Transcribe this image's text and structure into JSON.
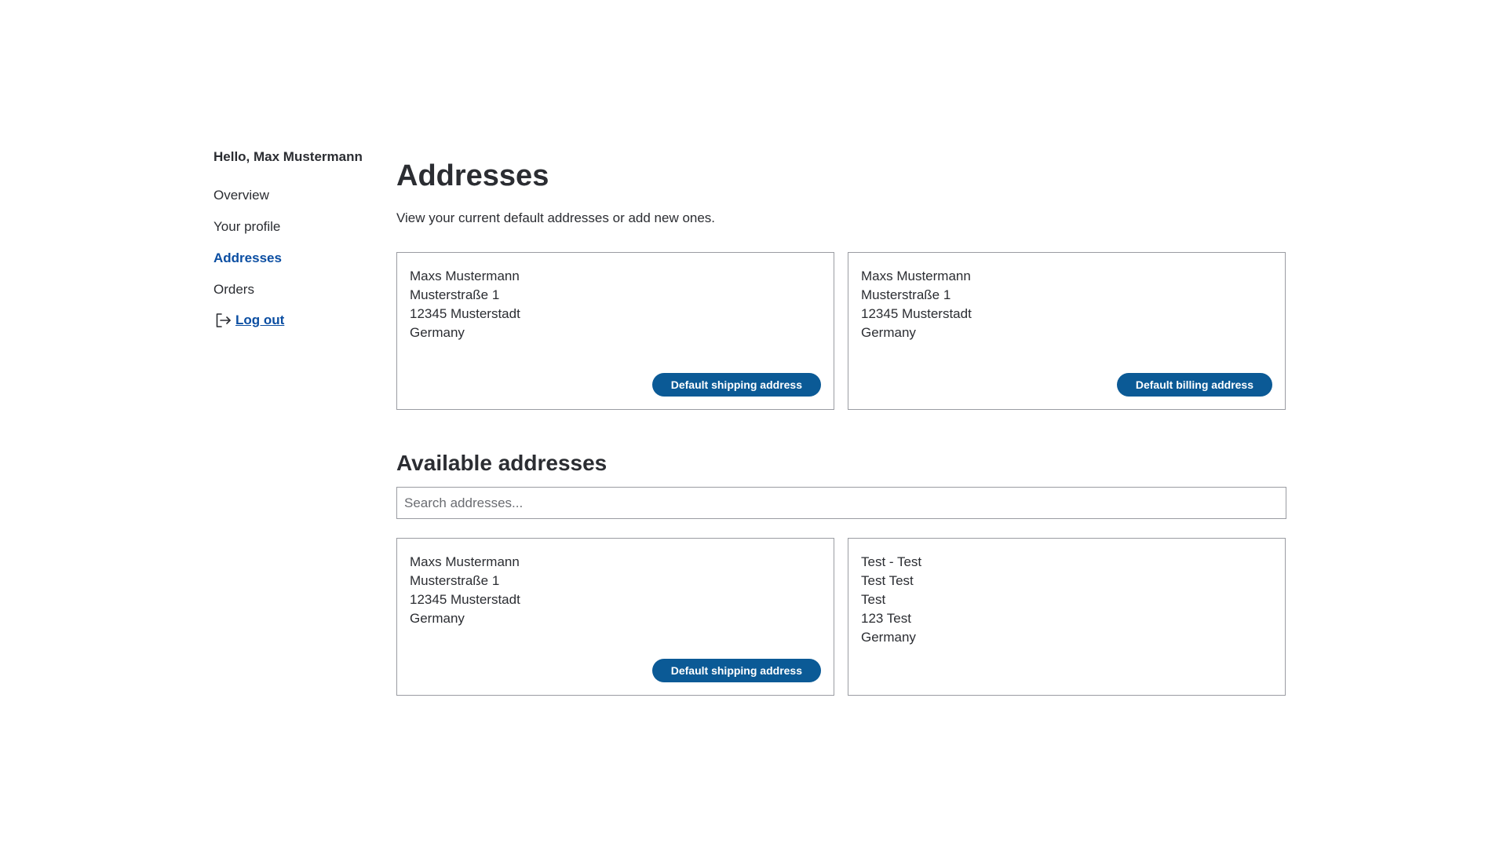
{
  "sidebar": {
    "greeting": "Hello, Max Mustermann",
    "items": [
      {
        "label": "Overview"
      },
      {
        "label": "Your profile"
      },
      {
        "label": "Addresses"
      },
      {
        "label": "Orders"
      }
    ],
    "logout_label": "Log out"
  },
  "main": {
    "title": "Addresses",
    "description": "View your current default addresses or add new ones.",
    "default_addresses": [
      {
        "lines": [
          "Maxs Mustermann",
          "Musterstraße 1",
          "12345 Musterstadt",
          "Germany"
        ],
        "badge": "Default shipping address"
      },
      {
        "lines": [
          "Maxs Mustermann",
          "Musterstraße 1",
          "12345 Musterstadt",
          "Germany"
        ],
        "badge": "Default billing address"
      }
    ],
    "available_title": "Available addresses",
    "search": {
      "placeholder": "Search addresses...",
      "value": ""
    },
    "available_addresses": [
      {
        "lines": [
          "Maxs Mustermann",
          "Musterstraße 1",
          "12345 Musterstadt",
          "Germany"
        ],
        "badge": "Default shipping address"
      },
      {
        "lines": [
          "Test - Test",
          "Test Test",
          "Test",
          "123 Test",
          "Germany"
        ]
      }
    ]
  },
  "colors": {
    "accent": "#0b4ea2",
    "badge_bg": "#0b5a96",
    "text": "#2b2d32",
    "border": "#9a9ca2"
  },
  "icons": {
    "logout": "logout-icon"
  }
}
